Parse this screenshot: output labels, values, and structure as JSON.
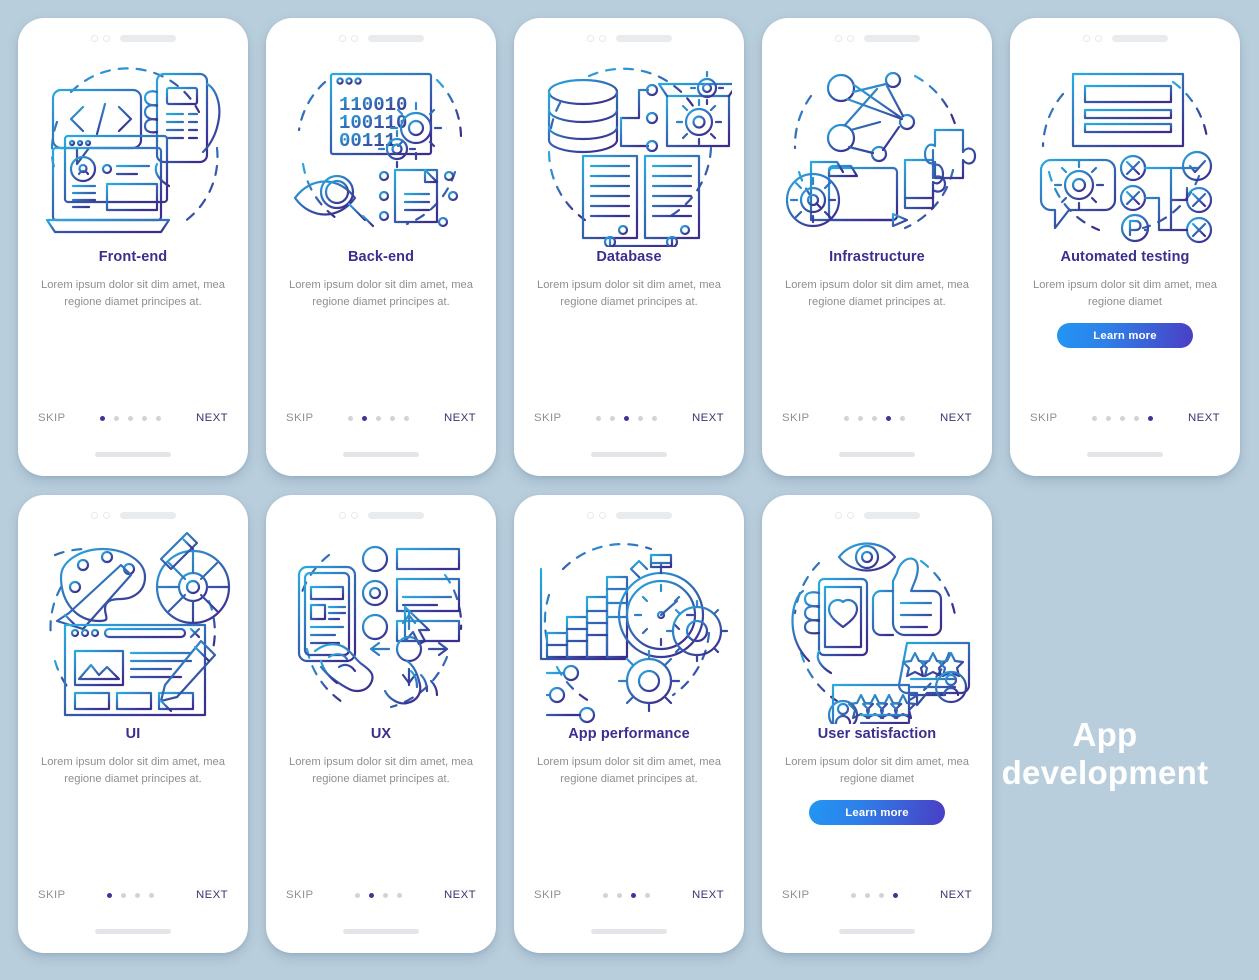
{
  "poster": {
    "title_line1": "App",
    "title_line2": "development"
  },
  "theme": {
    "background": "#b9cedc",
    "card_background": "#ffffff",
    "title_color": "#3b2f8e",
    "body_color": "#8d8f93",
    "next_color": "#3a3470",
    "skip_color": "#8e9095",
    "dot_active": "#403495",
    "dot_inactive": "#d2d3d6",
    "button_gradient_from": "#2196f3",
    "button_gradient_to": "#4a3ec4",
    "line_gradient_from": "#29abe2",
    "line_gradient_to": "#3b2f8e"
  },
  "common": {
    "skip_label": "SKIP",
    "next_label": "NEXT",
    "learn_more_label": "Learn more",
    "description_full": "Lorem ipsum dolor sit dim amet, mea regione diamet principes at.",
    "description_short": "Lorem ipsum dolor sit dim amet, mea regione diamet"
  },
  "screens": [
    {
      "id": "front-end",
      "title": "Front-end",
      "description": "Lorem ipsum dolor sit dim amet, mea regione diamet principes at.",
      "dots_total": 5,
      "dots_active_index": 0,
      "has_learn_more": false,
      "illustration": "code-bubble-laptop-phone",
      "illustration_text": "</>"
    },
    {
      "id": "back-end",
      "title": "Back-end",
      "description": "Lorem ipsum dolor sit dim amet, mea regione diamet principes at.",
      "dots_total": 5,
      "dots_active_index": 1,
      "has_learn_more": false,
      "illustration": "binary-window-gear-eye-document",
      "binary_lines": [
        "110010",
        "100110",
        "00111"
      ]
    },
    {
      "id": "database",
      "title": "Database",
      "description": "Lorem ipsum dolor sit dim amet, mea regione diamet principes at.",
      "dots_total": 5,
      "dots_active_index": 2,
      "has_learn_more": false,
      "illustration": "database-cylinder-servers-box-gears"
    },
    {
      "id": "infrastructure",
      "title": "Infrastructure",
      "description": "Lorem ipsum dolor sit dim amet, mea regione diamet principes at.",
      "dots_total": 5,
      "dots_active_index": 3,
      "has_learn_more": false,
      "illustration": "network-nodes-folder-puzzle-gear"
    },
    {
      "id": "automated-testing",
      "title": "Automated testing",
      "description": "Lorem ipsum dolor sit dim amet, mea regione diamet",
      "dots_total": 5,
      "dots_active_index": 4,
      "has_learn_more": true,
      "learn_more_label": "Learn more",
      "illustration": "window-chat-gear-checks-crosses"
    },
    {
      "id": "ui",
      "title": "UI",
      "description": "Lorem ipsum dolor sit dim amet, mea regione diamet principes at.",
      "dots_total": 4,
      "dots_active_index": 0,
      "has_learn_more": false,
      "illustration": "palette-brush-colorwheel-webpage-pencil"
    },
    {
      "id": "ux",
      "title": "UX",
      "description": "Lorem ipsum dolor sit dim amet, mea regione diamet principes at.",
      "dots_total": 4,
      "dots_active_index": 1,
      "has_learn_more": false,
      "illustration": "phone-hand-radio-buttons-cursor-pinch"
    },
    {
      "id": "app-performance",
      "title": "App performance",
      "description": "Lorem ipsum dolor sit dim amet, mea regione diamet principes at.",
      "dots_total": 4,
      "dots_active_index": 2,
      "has_learn_more": false,
      "illustration": "bar-chart-stopwatch-gears-sliders"
    },
    {
      "id": "user-satisfaction",
      "title": "User satisfaction",
      "description": "Lorem ipsum dolor sit dim amet, mea regione diamet",
      "dots_total": 4,
      "dots_active_index": 3,
      "has_learn_more": true,
      "learn_more_label": "Learn more",
      "illustration": "eye-thumbsup-phone-heart-reviews-stars"
    }
  ]
}
